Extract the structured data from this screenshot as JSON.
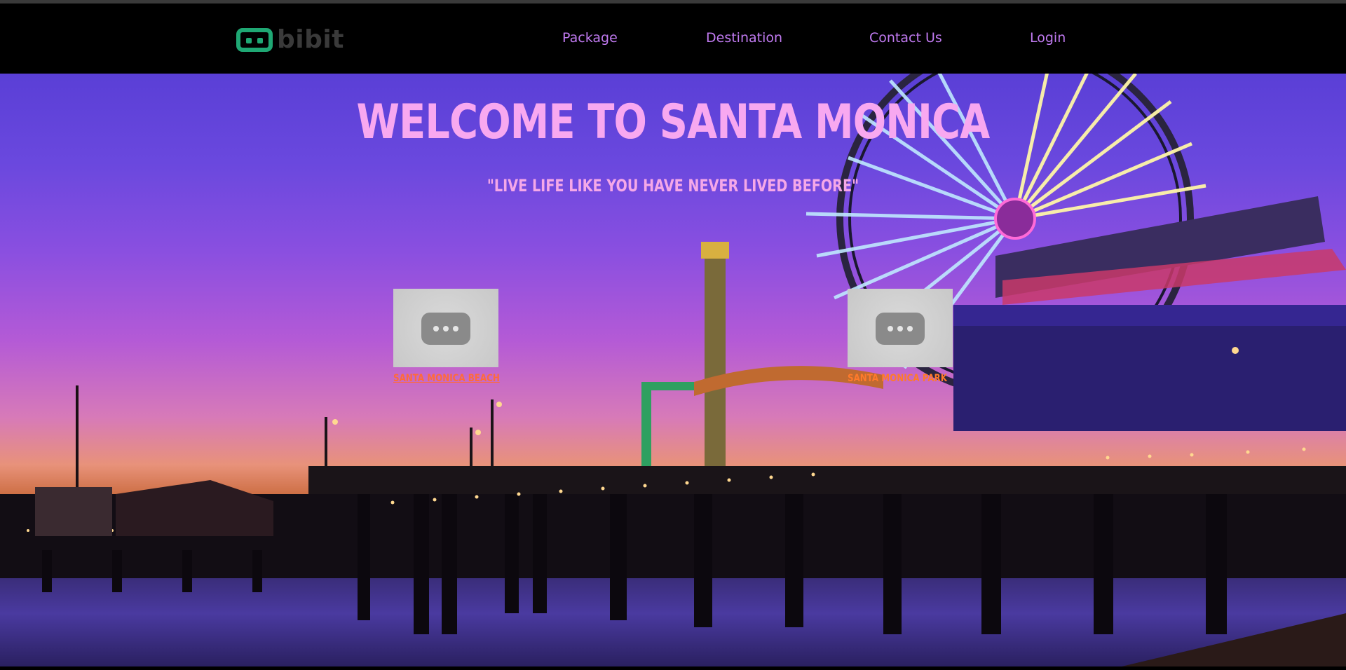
{
  "header": {
    "logo_text": "bibit",
    "nav": {
      "package": "Package",
      "destination": "Destination",
      "contact": "Contact Us",
      "login": "Login"
    }
  },
  "hero": {
    "title": "WELCOME TO SANTA MONICA",
    "subtitle": "\"LIVE LIFE LIKE YOU HAVE NEVER LIVED BEFORE\"",
    "background": "santa-monica-pier-ferris-wheel-sunset"
  },
  "cards": [
    {
      "label": "SANTA MONICA BEACH",
      "thumb_icon": "video-play-icon"
    },
    {
      "label": "SANTA MONICA PARK",
      "thumb_icon": "video-play-icon"
    }
  ],
  "colors": {
    "nav_link": "#c07af0",
    "logo_green": "#1fa874",
    "title_pink": "#f8a8f0",
    "card_link": "#ff6a3a"
  }
}
